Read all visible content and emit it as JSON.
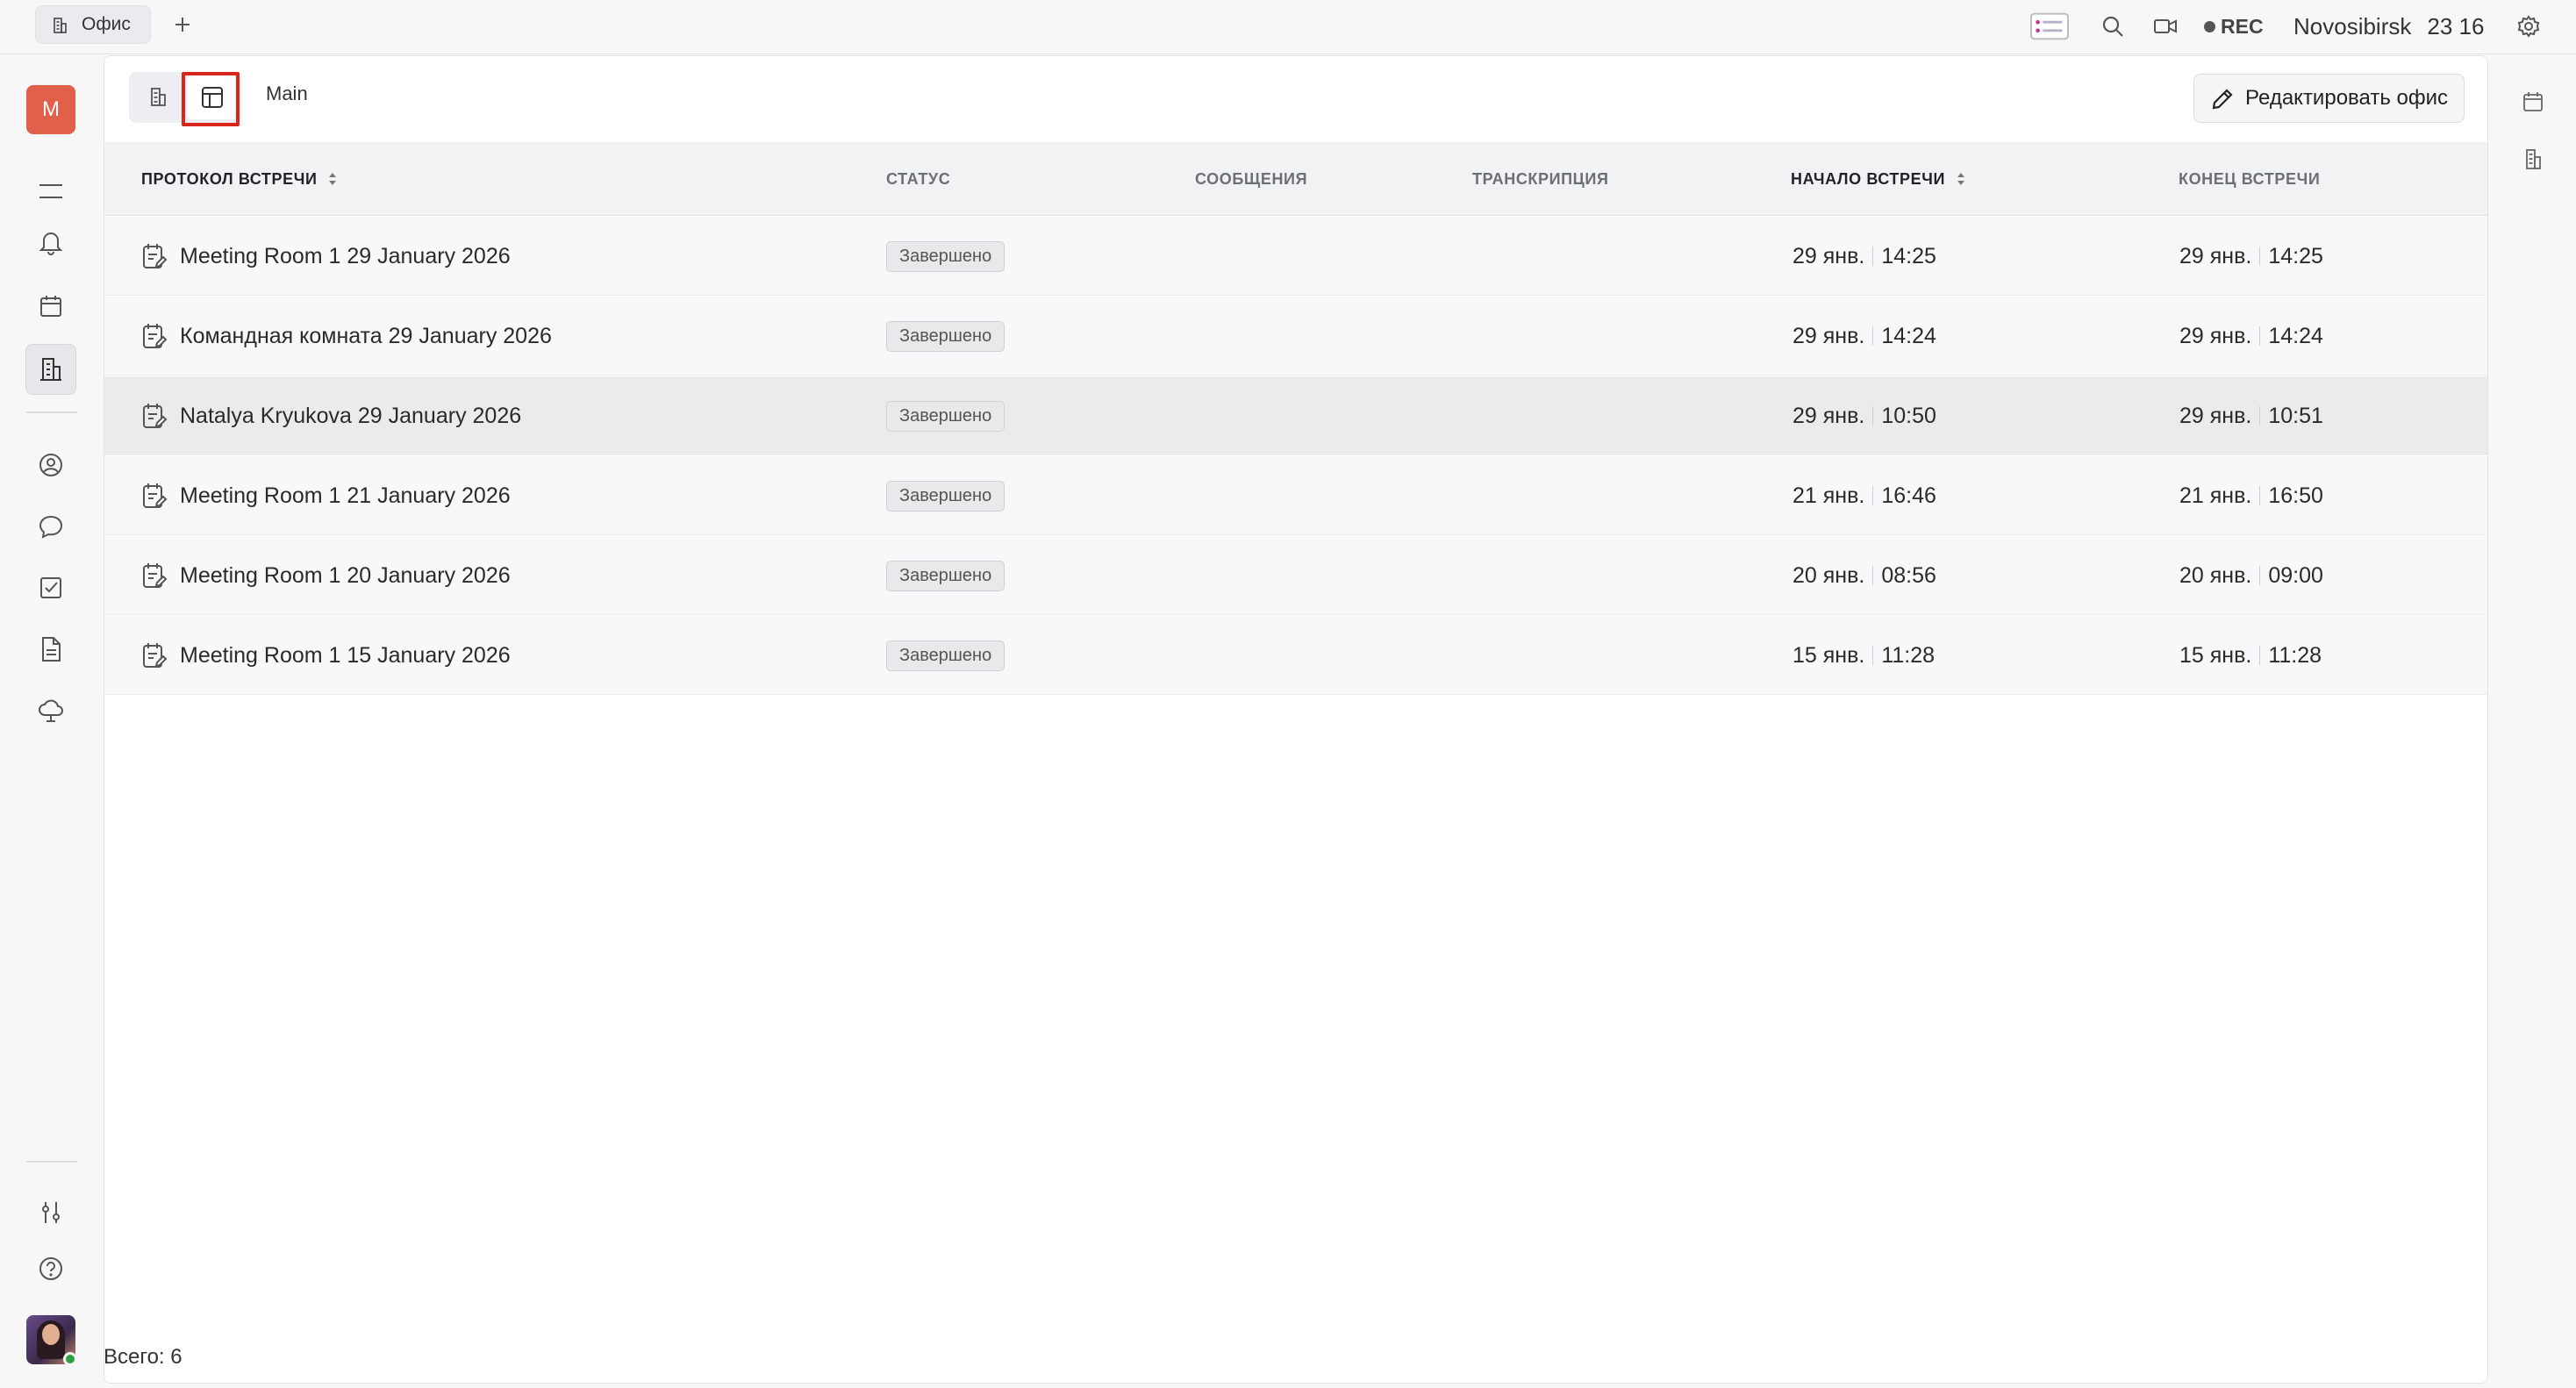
{
  "topbar": {
    "tab_label": "Офис",
    "rec_label": "REC",
    "location": "Novosibirsk",
    "time": "23 16"
  },
  "main": {
    "breadcrumb": "Main",
    "edit_button": "Редактировать офис",
    "columns": {
      "protocol": "ПРОТОКОЛ ВСТРЕЧИ",
      "status": "СТАТУС",
      "messages": "СООБЩЕНИЯ",
      "transcription": "ТРАНСКРИПЦИЯ",
      "start": "НАЧАЛО ВСТРЕЧИ",
      "end": "КОНЕЦ ВСТРЕЧИ"
    },
    "rows": [
      {
        "name": "Meeting Room 1 29 January 2026",
        "status": "Завершено",
        "start_date": "29 янв.",
        "start_time": "14:25",
        "end_date": "29 янв.",
        "end_time": "14:25"
      },
      {
        "name": "Командная комната 29 January 2026",
        "status": "Завершено",
        "start_date": "29 янв.",
        "start_time": "14:24",
        "end_date": "29 янв.",
        "end_time": "14:24"
      },
      {
        "name": "Natalya Kryukova 29 January 2026",
        "status": "Завершено",
        "start_date": "29 янв.",
        "start_time": "10:50",
        "end_date": "29 янв.",
        "end_time": "10:51"
      },
      {
        "name": "Meeting Room 1 21 January 2026",
        "status": "Завершено",
        "start_date": "21 янв.",
        "start_time": "16:46",
        "end_date": "21 янв.",
        "end_time": "16:50"
      },
      {
        "name": "Meeting Room 1 20 January 2026",
        "status": "Завершено",
        "start_date": "20 янв.",
        "start_time": "08:56",
        "end_date": "20 янв.",
        "end_time": "09:00"
      },
      {
        "name": "Meeting Room 1 15 January 2026",
        "status": "Завершено",
        "start_date": "15 янв.",
        "start_time": "11:28",
        "end_date": "15 янв.",
        "end_time": "11:28"
      }
    ]
  },
  "sidebar": {
    "workspace_initial": "M"
  },
  "footer": {
    "total": "Всего: 6"
  },
  "colors": {
    "accent_red": "#d9261c",
    "workspace_avatar": "#e0604a",
    "online": "#2ea043"
  }
}
